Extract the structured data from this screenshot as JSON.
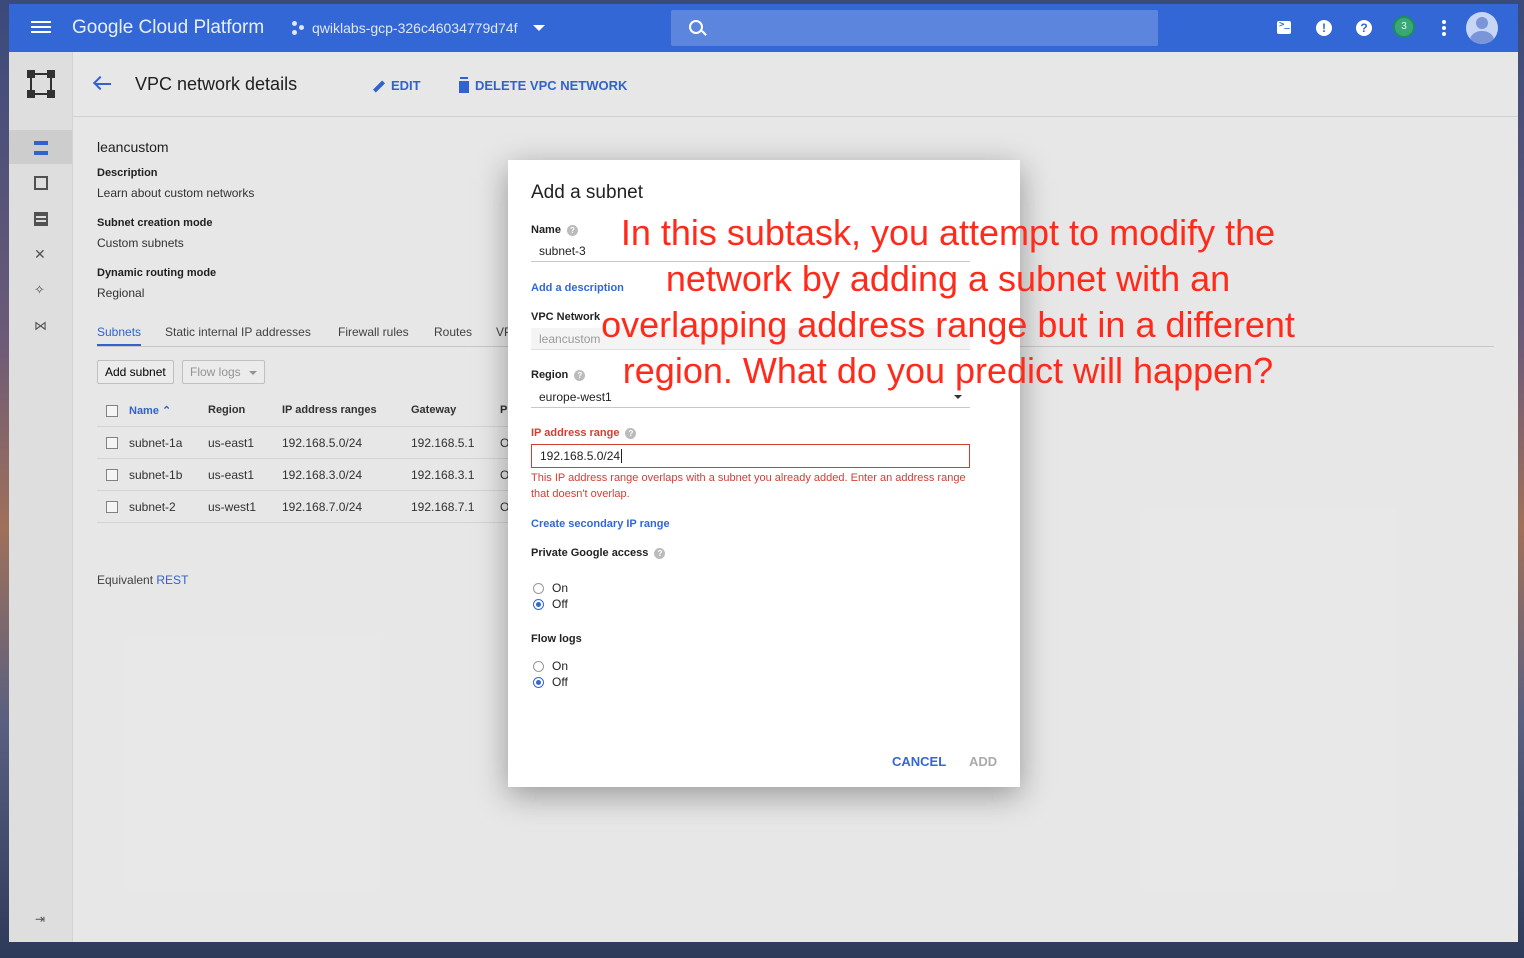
{
  "topbar": {
    "brand": "Google Cloud Platform",
    "project": "qwiklabs-gcp-326c46034779d74f",
    "notifications_count": "3",
    "search_placeholder": ""
  },
  "header": {
    "title": "VPC network details",
    "edit_label": "EDIT",
    "delete_label": "DELETE VPC NETWORK"
  },
  "network": {
    "name": "leancustom",
    "description_label": "Description",
    "description_value": "Learn about custom networks",
    "subnet_mode_label": "Subnet creation mode",
    "subnet_mode_value": "Custom subnets",
    "routing_mode_label": "Dynamic routing mode",
    "routing_mode_value": "Regional"
  },
  "tabs": [
    "Subnets",
    "Static internal IP addresses",
    "Firewall rules",
    "Routes",
    "VP"
  ],
  "actions": {
    "add_subnet": "Add subnet",
    "flow_logs": "Flow logs"
  },
  "table": {
    "headers": [
      "Name",
      "Region",
      "IP address ranges",
      "Gateway",
      "P"
    ],
    "rows": [
      [
        "subnet-1a",
        "us-east1",
        "192.168.5.0/24",
        "192.168.5.1",
        "O"
      ],
      [
        "subnet-1b",
        "us-east1",
        "192.168.3.0/24",
        "192.168.3.1",
        "O"
      ],
      [
        "subnet-2",
        "us-west1",
        "192.168.7.0/24",
        "192.168.7.1",
        "O"
      ]
    ]
  },
  "rest": {
    "prefix": "Equivalent",
    "link": "REST"
  },
  "dialog": {
    "title": "Add a subnet",
    "name_label": "Name",
    "name_value": "subnet-3",
    "add_description": "Add a description",
    "vpc_label": "VPC Network",
    "vpc_value": "leancustom",
    "region_label": "Region",
    "region_value": "europe-west1",
    "ip_label": "IP address range",
    "ip_value": "192.168.5.0/24",
    "ip_error": "This IP address range overlaps with a subnet you already added. Enter an address range that doesn't overlap.",
    "secondary_link": "Create secondary IP range",
    "pga_label": "Private Google access",
    "pga_on": "On",
    "pga_off": "Off",
    "pga_selected": "Off",
    "flow_label": "Flow logs",
    "flow_on": "On",
    "flow_off": "Off",
    "flow_selected": "Off",
    "cancel": "CANCEL",
    "add": "ADD"
  },
  "annotation": "In this subtask, you attempt to modify the network by adding a subnet with an overlapping address range but in a different region. What do you predict will happen?",
  "colors": {
    "topbar": "#3367d6",
    "accent": "#3367d6",
    "error": "#d23f31",
    "annotation": "#ff2a1a"
  }
}
